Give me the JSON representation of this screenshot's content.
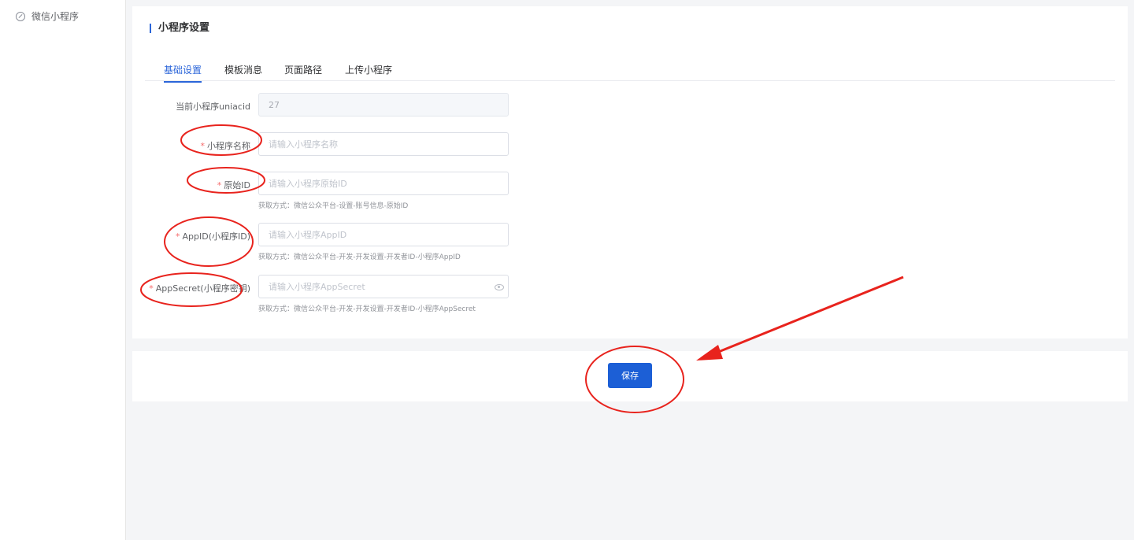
{
  "sidebar": {
    "items": [
      {
        "label": "微信小程序",
        "icon": "link-icon"
      }
    ]
  },
  "card": {
    "title": "小程序设置",
    "tabs": [
      {
        "label": "基础设置",
        "active": true
      },
      {
        "label": "模板消息",
        "active": false
      },
      {
        "label": "页面路径",
        "active": false
      },
      {
        "label": "上传小程序",
        "active": false
      }
    ]
  },
  "form": {
    "uniacid": {
      "label": "当前小程序uniacid",
      "value": "27"
    },
    "name": {
      "required": "*",
      "label": "小程序名称",
      "placeholder": "请输入小程序名称"
    },
    "original_id": {
      "required": "*",
      "label": "原始ID",
      "placeholder": "请输入小程序原始ID",
      "hint": "获取方式：微信公众平台-设置-账号信息-原始ID"
    },
    "appid": {
      "required": "*",
      "label": "AppID(小程序ID)",
      "placeholder": "请输入小程序AppID",
      "hint": "获取方式：微信公众平台-开发-开发设置-开发者ID-小程序AppID"
    },
    "appsecret": {
      "required": "*",
      "label": "AppSecret(小程序密钥)",
      "placeholder": "请输入小程序AppSecret",
      "hint": "获取方式：微信公众平台-开发-开发设置-开发者ID-小程序AppSecret",
      "icon": "eye-icon"
    }
  },
  "footer": {
    "save_label": "保存"
  },
  "colors": {
    "primary": "#1c5fd6",
    "required": "#f56c6c",
    "annotation": "#e8231d"
  }
}
